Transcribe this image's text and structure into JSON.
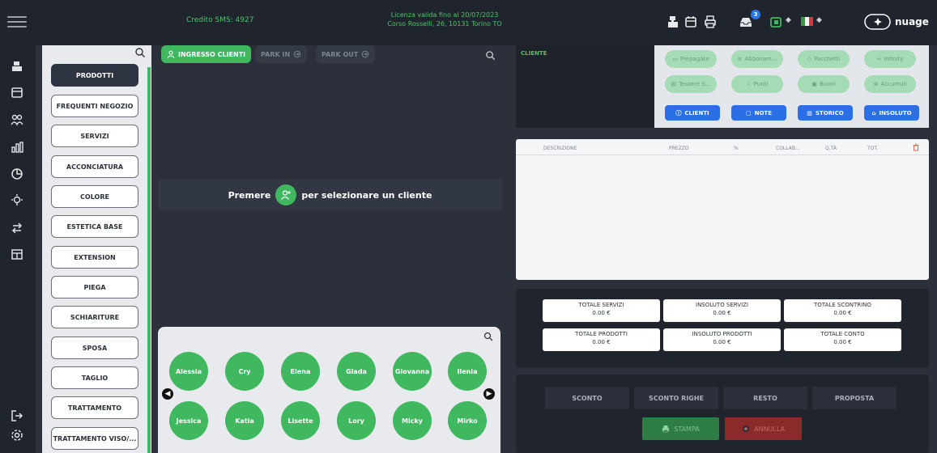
{
  "topbar": {
    "sms_credit": "Credito SMS: 4927",
    "license_line1": "Licenza valida fino al 20/07/2023",
    "license_line2": "Corso Rosselli, 26, 10131 Torino TO",
    "notification_count": "3",
    "logo_text": "nuage"
  },
  "categories": {
    "items": [
      "PRODOTTI",
      "FREQUENTI NEGOZIO",
      "SERVIZI",
      "ACCONCIATURA",
      "COLORE",
      "ESTETICA BASE",
      "EXTENSION",
      "PIEGA",
      "SCHIARITURE",
      "SPOSA",
      "TAGLIO",
      "TRATTAMENTO",
      "TRATTAMENTO VISO/..."
    ],
    "active": "PRODOTTI"
  },
  "client_area": {
    "ingresso_label": "INGRESSO CLIENTI",
    "park_in_label": "PARK IN",
    "park_out_label": "PARK OUT",
    "prompt_before": "Premere",
    "prompt_after": "per selezionare un cliente"
  },
  "collaborators": {
    "row1": [
      "Alessia",
      "Cry",
      "Elena",
      "Giada",
      "Giovanna",
      "Ilenia"
    ],
    "row2": [
      "Jessica",
      "Katia",
      "Lisette",
      "Lory",
      "Micky",
      "Mirko"
    ]
  },
  "client_panel": {
    "label": "CLIENTE",
    "loyalty": [
      "Prepagate",
      "Abbonam...",
      "Pacchetti",
      "Infinity",
      "Tessere S...",
      "Punti",
      "Buoni",
      "Accumuli"
    ],
    "buttons": [
      "CLIENTI",
      "NOTE",
      "STORICO",
      "INSOLUTO"
    ]
  },
  "receipt": {
    "headers": [
      "DESCRIZIONE",
      "PREZZO",
      "%",
      "COLLAB...",
      "Q.TÀ",
      "TOT."
    ]
  },
  "totals": [
    {
      "label": "TOTALE SERVIZI",
      "value": "0.00 €"
    },
    {
      "label": "INSOLUTO SERVIZI",
      "value": "0.00 €"
    },
    {
      "label": "TOTALE SCONTRINO",
      "value": "0.00 €"
    },
    {
      "label": "TOTALE PRODOTTI",
      "value": "0.00 €"
    },
    {
      "label": "INSOLUTO PRODOTTI",
      "value": "0.00 €"
    },
    {
      "label": "TOTALE CONTO",
      "value": "0.00 €"
    }
  ],
  "actions": {
    "sconto": "SCONTO",
    "sconto_righe": "SCONTO RIGHE",
    "resto": "RESTO",
    "proposta": "PROPOSTA",
    "stampa": "STAMPA",
    "annulla": "ANNULLA"
  },
  "colors": {
    "accent_green": "#3fb85f",
    "accent_blue": "#2b6fe6",
    "background_dark": "#2b303a",
    "panel_dark": "#20252d"
  }
}
